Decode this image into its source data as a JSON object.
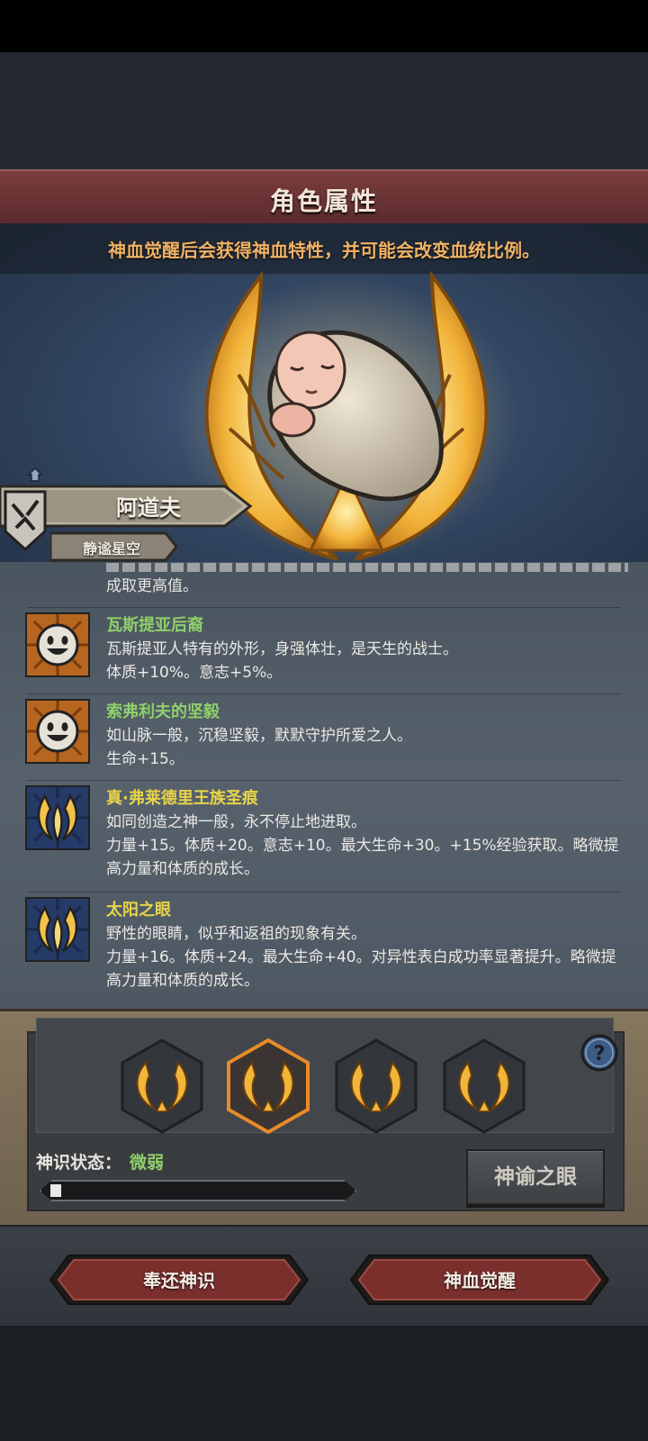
{
  "screen": {
    "title": "角色属性",
    "notice": "神血觉醒后会获得神血特性，并可能会改变血统比例。"
  },
  "character": {
    "name": "阿道夫",
    "subtitle": "静谧星空"
  },
  "traits": {
    "partial_tail": "成取更高值。",
    "items": [
      {
        "name": "瓦斯提亚后裔",
        "name_color": "#8fd06a",
        "icon": "smiley-face-icon",
        "line1": "瓦斯提亚人特有的外形，身强体壮，是天生的战士。",
        "line2": "体质+10%。意志+5%。"
      },
      {
        "name": "索弗利夫的坚毅",
        "name_color": "#8fd06a",
        "icon": "smiley-face-icon",
        "line1": "如山脉一般，沉稳坚毅，默默守护所爱之人。",
        "line2": "生命+15。"
      },
      {
        "name": "真·弗莱德里王族圣痕",
        "name_color": "#e8d44a",
        "icon": "golden-flame-icon",
        "line1": "如同创造之神一般，永不停止地进取。",
        "line2": "力量+15。体质+20。意志+10。最大生命+30。+15%经验获取。略微提高力量和体质的成长。"
      },
      {
        "name": "太阳之眼",
        "name_color": "#e8d44a",
        "icon": "golden-flame-icon",
        "line1": "野性的眼睛，似乎和返祖的现象有关。",
        "line2": "力量+16。体质+24。最大生命+40。对异性表白成功率显著提升。略微提高力量和体质的成长。"
      }
    ]
  },
  "divine": {
    "slots": [
      "divine-wreath-icon",
      "divine-wreath-icon",
      "divine-wreath-icon",
      "divine-wreath-icon"
    ],
    "selected_slot": 1,
    "status_label": "神识状态：",
    "status_value": "微弱",
    "progress": 0.03,
    "oracle_button": "神谕之眼"
  },
  "actions": {
    "return_button": "奉还神识",
    "awaken_button": "神血觉醒"
  },
  "colors": {
    "accent_gold": "#f0b366",
    "status_green": "#8fd06a",
    "title_red": "#6b3234"
  }
}
